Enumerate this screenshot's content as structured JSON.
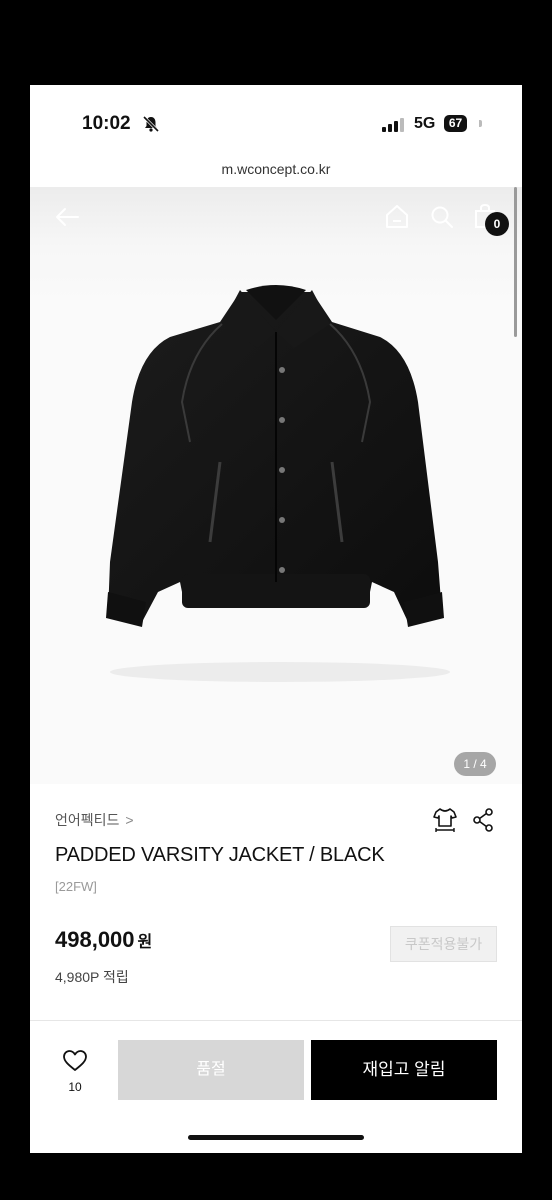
{
  "status_bar": {
    "time": "10:02",
    "network": "5G",
    "battery": "67",
    "battery_fraction": 0.67
  },
  "browser": {
    "url": "m.wconcept.co.kr"
  },
  "header": {
    "cart_count": "0"
  },
  "gallery": {
    "pager": "1 / 4"
  },
  "product": {
    "brand": "언어펙티드",
    "brand_chevron": ">",
    "title": "PADDED VARSITY JACKET / BLACK",
    "tag": "[22FW]",
    "price": "498,000",
    "price_unit": "원",
    "coupon_label": "쿠폰적용불가",
    "points": "4,980P 적립"
  },
  "bottom_bar": {
    "wish_count": "10",
    "soldout_label": "품절",
    "restock_label": "재입고 알림"
  },
  "colors": {
    "accent": "#000000",
    "disabled": "#d7d7d7",
    "badge": "#111111"
  }
}
